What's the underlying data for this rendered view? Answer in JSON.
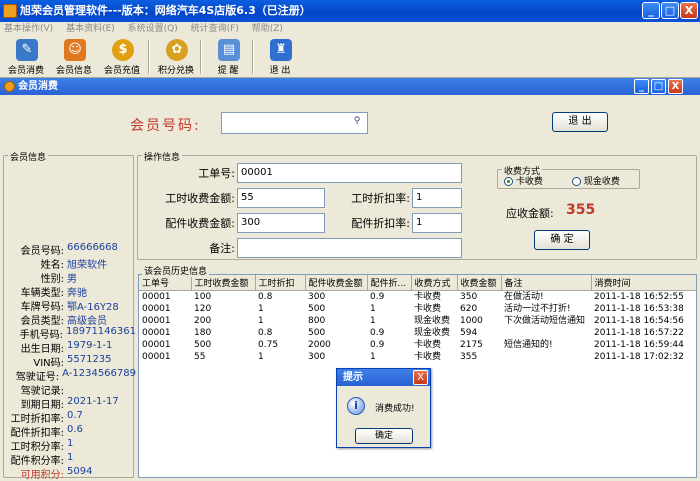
{
  "window": {
    "title": "旭荣会员管理软件---版本：网络汽车4S店版6.3（已注册）",
    "minimize": "_",
    "maximize": "□",
    "close": "X"
  },
  "menu": [
    "基本操作(V)",
    "基本资料(E)",
    "系统设置(Q)",
    "统计查询(F)",
    "帮助(Z)"
  ],
  "toolbar": [
    {
      "label": "会员消费",
      "icon": "member-consume-icon"
    },
    {
      "label": "会员信息",
      "icon": "member-info-icon"
    },
    {
      "label": "会员充值",
      "icon": "recharge-icon"
    },
    {
      "label": "积分兑换",
      "icon": "points-exchange-icon"
    },
    {
      "label": "提 醒",
      "icon": "reminder-icon"
    },
    {
      "label": "退 出",
      "icon": "exit-icon"
    }
  ],
  "subwindow": {
    "title": "会员消费"
  },
  "search": {
    "label": "会员号码:",
    "value": "",
    "exit_label": "退 出"
  },
  "member_panel": {
    "title": "会员信息",
    "rows": [
      {
        "label": "会员号码:",
        "value": "66666668"
      },
      {
        "label": "姓名:",
        "value": "旭荣软件"
      },
      {
        "label": "性别:",
        "value": "男"
      },
      {
        "label": "车辆类型:",
        "value": "奔驰"
      },
      {
        "label": "车牌号码:",
        "value": "鄂A-16Y28"
      },
      {
        "label": "会员类型:",
        "value": "高级会员"
      },
      {
        "label": "手机号码:",
        "value": "18971146361"
      },
      {
        "label": "出生日期:",
        "value": "1979-1-1"
      },
      {
        "label": "VIN码:",
        "value": "5571235"
      },
      {
        "label": "驾驶证号:",
        "value": "A-1234566789"
      },
      {
        "label": "驾驶记录:",
        "value": ""
      },
      {
        "label": "到期日期:",
        "value": "2021-1-17"
      },
      {
        "label": "工时折扣率:",
        "value": "0.7"
      },
      {
        "label": "配件折扣率:",
        "value": "0.6"
      },
      {
        "label": "工时积分率:",
        "value": "1"
      },
      {
        "label": "配件积分率:",
        "value": "1"
      },
      {
        "label": "可用积分:",
        "value": "5094"
      }
    ]
  },
  "op_panel": {
    "title": "操作信息",
    "work_no_label": "工单号:",
    "work_no_value": "00001",
    "labor_fee_label": "工时收费金额:",
    "labor_fee_value": "55",
    "labor_rate_label": "工时折扣率:",
    "labor_rate_value": "1",
    "parts_fee_label": "配件收费金额:",
    "parts_fee_value": "300",
    "parts_rate_label": "配件折扣率:",
    "parts_rate_value": "1",
    "remark_label": "备注:",
    "remark_value": "",
    "pay_method_title": "收费方式",
    "pay_card": "卡收费",
    "pay_cash": "现金收费",
    "amount_label": "应收金额:",
    "amount_value": "355",
    "confirm_label": "确 定"
  },
  "history": {
    "title": "该会员历史信息",
    "headers": [
      "工单号",
      "工时收费金额",
      "工时折扣",
      "配件收费金额",
      "配件折...",
      "收费方式",
      "收费金额",
      "备注",
      "消费时间"
    ],
    "rows": [
      [
        "00001",
        "100",
        "0.8",
        "300",
        "0.9",
        "卡收费",
        "350",
        "在做活动!",
        "2011-1-18 16:52:55"
      ],
      [
        "00001",
        "120",
        "1",
        "500",
        "1",
        "卡收费",
        "620",
        "活动一过不打折!",
        "2011-1-18 16:53:38"
      ],
      [
        "00001",
        "200",
        "1",
        "800",
        "1",
        "现金收费",
        "1000",
        "下次做活动短信通知",
        "2011-1-18 16:54:56"
      ],
      [
        "00001",
        "180",
        "0.8",
        "500",
        "0.9",
        "现金收费",
        "594",
        "",
        "2011-1-18 16:57:22"
      ],
      [
        "00001",
        "500",
        "0.75",
        "2000",
        "0.9",
        "卡收费",
        "2175",
        "短信通知的!",
        "2011-1-18 16:59:44"
      ],
      [
        "00001",
        "55",
        "1",
        "300",
        "1",
        "卡收费",
        "355",
        "",
        "2011-1-18 17:02:32"
      ]
    ]
  },
  "dialog": {
    "title": "提示",
    "message": "消费成功!",
    "ok_label": "确定",
    "close": "X",
    "icon_glyph": "i"
  }
}
